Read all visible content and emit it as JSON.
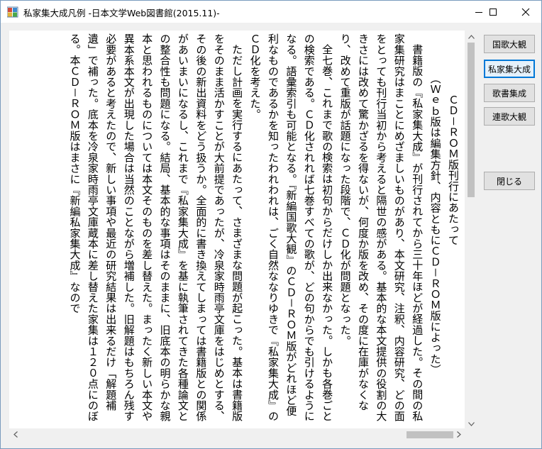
{
  "window": {
    "title": "私家集大成凡例 -日本文学Web図書館(2015.11)-",
    "minimize_icon": "minimize-icon",
    "maximize_icon": "maximize-icon",
    "close_icon": "close-icon"
  },
  "sidebar": {
    "buttons": [
      {
        "label": "国歌大観"
      },
      {
        "label": "私家集大成"
      },
      {
        "label": "歌書集成"
      },
      {
        "label": "連歌大観"
      }
    ],
    "close_label": "閉じる"
  },
  "document": {
    "heading": "ＣＤ－ＲＯＭ版刊行にあたって",
    "subheading": "（Ｗｅｂ版は編集方針、内容ともにＣＤ－ＲＯＭ版によった）",
    "paragraphs": [
      "書籍版の『私家集大成』が刊行されてから三十年ほどが経過した。その間の私家集研究はまことにめざましいものがあり、本文研究、注釈、内容研究、どの面をとっても刊行当初から考えると隔世の感がある。基本的な本文提供の役割の大きさには改めて驚かざるを得ないが、何度か版を改め、その度に在庫がなくなり、改めて重版が話題になった段階で、ＣＤ化が問題となった。",
      "全七巻、これまで歌の検索は初句からだけしか出来なかった。しかも各巻ごとの検索である。ＣＤ化されれば七巻すべての歌が、どの句からでも引けるようになる。語彙索引も可能となる。『新編国歌大観』のＣＤ－ＲＯＭ版がどれほど便利なものであるかを知ったわれわれは、ごく自然ななりゆきで『私家集大成』のＣＤ化を考えた。",
      "ただし計画を実行するにあたって、さまざまな問題が起こった。基本は書籍版をそのまま活かすことが大前提であったが、冷泉家時雨亭文庫をはじめとする、その後の新出資料をどう扱うか。全面的に書き換えてしまっては書籍版との関係があいまいになるし、これまで『私家集大成』を基に執筆されてきた各種論文との整合性も問題になる。結局、基本的な事項はそのままに、旧底本の明らかな親本と思われるものについては本文そのものを差し替えた。まったく新しい本文や異本系本文が出現した場合は当然のことながら増補した。旧解題はもちろん残す必要があると考えたので、新しい事項や最近の研究結果は出来るだけ「解題補遺」で補った。底本を冷泉家時雨亭文庫蔵本に差し替えた家集は１２０点にのぼる。本ＣＤ－ＲＯＭ版はまさに『新編私家集大成』なので"
    ]
  }
}
